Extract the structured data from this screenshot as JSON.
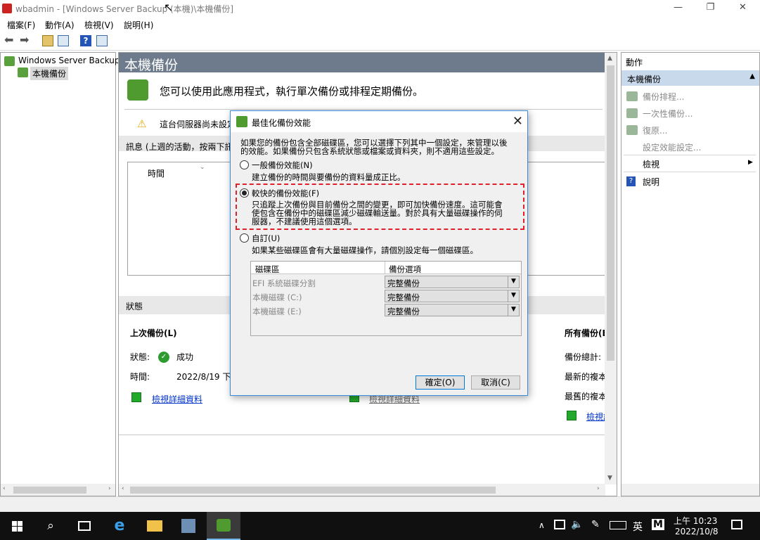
{
  "window": {
    "title": "wbadmin - [Windows Server Backup (本機)\\本機備份]"
  },
  "menu": {
    "items": [
      "檔案(F)",
      "動作(A)",
      "檢視(V)",
      "說明(H)"
    ]
  },
  "tree": {
    "root": "Windows Server Backup",
    "child": "本機備份"
  },
  "main": {
    "heading": "本機備份",
    "intro": "您可以使用此應用程式，執行單次備份或排程定期備份。",
    "warning": "這台伺服器尚未設定",
    "messages_label": "訊息 (上週的活動，按兩下訊",
    "col_time": "時間",
    "status_section": "狀態",
    "last_backup_title": "上次備份(L)",
    "status_label": "狀態:",
    "status_value": "成功",
    "time_label": "時間:",
    "time_value": "2022/8/19 下午",
    "view_details_link": "檢視詳細資料",
    "view_details_link2": "檢視詳細資料",
    "all_backups_title": "所有備份(B",
    "backup_total": "備份總計:",
    "newest_copy": "最新的複本",
    "oldest_copy": "最舊的複本",
    "view_link3": "檢視詳"
  },
  "actions": {
    "header": "動作",
    "selected": "本機備份",
    "items": [
      "備份排程...",
      "一次性備份...",
      "復原...",
      "設定效能設定...",
      "檢視",
      "說明"
    ]
  },
  "dialog": {
    "title": "最佳化備份效能",
    "intro_line1": "如果您的備份包含全部磁碟區，您可以選擇下列其中一個設定，來管理以後",
    "intro_line2": "的效能。如果備份只包含系統狀態或檔案或資料夾，則不適用這些設定。",
    "opt1_label": "一般備份效能(N)",
    "opt1_desc": "建立備份的時間與要備份的資料量成正比。",
    "opt2_label": "較快的備份效能(F)",
    "opt2_desc1": "只追蹤上次備份與目前備份之間的變更，即可加快備份速度。這可能會",
    "opt2_desc2": "使包含在備份中的磁碟區減少磁碟輸送量。對於具有大量磁碟操作的伺",
    "opt2_desc3": "服器，不建議使用這個選項。",
    "opt3_label": "自訂(U)",
    "opt3_desc": "如果某些磁碟區會有大量磁碟操作，請個別設定每一個磁碟區。",
    "grid_col1": "磁碟區",
    "grid_col2": "備份選項",
    "rows": [
      {
        "volume": "EFI 系統磁碟分割",
        "option": "完整備份"
      },
      {
        "volume": "本機磁碟 (C:)",
        "option": "完整備份"
      },
      {
        "volume": "本機磁碟 (E:)",
        "option": "完整備份"
      }
    ],
    "ok": "確定(O)",
    "cancel": "取消(C)"
  },
  "taskbar": {
    "time": "上午 10:23",
    "date": "2022/10/8",
    "ime": "英",
    "ime2": "M"
  }
}
